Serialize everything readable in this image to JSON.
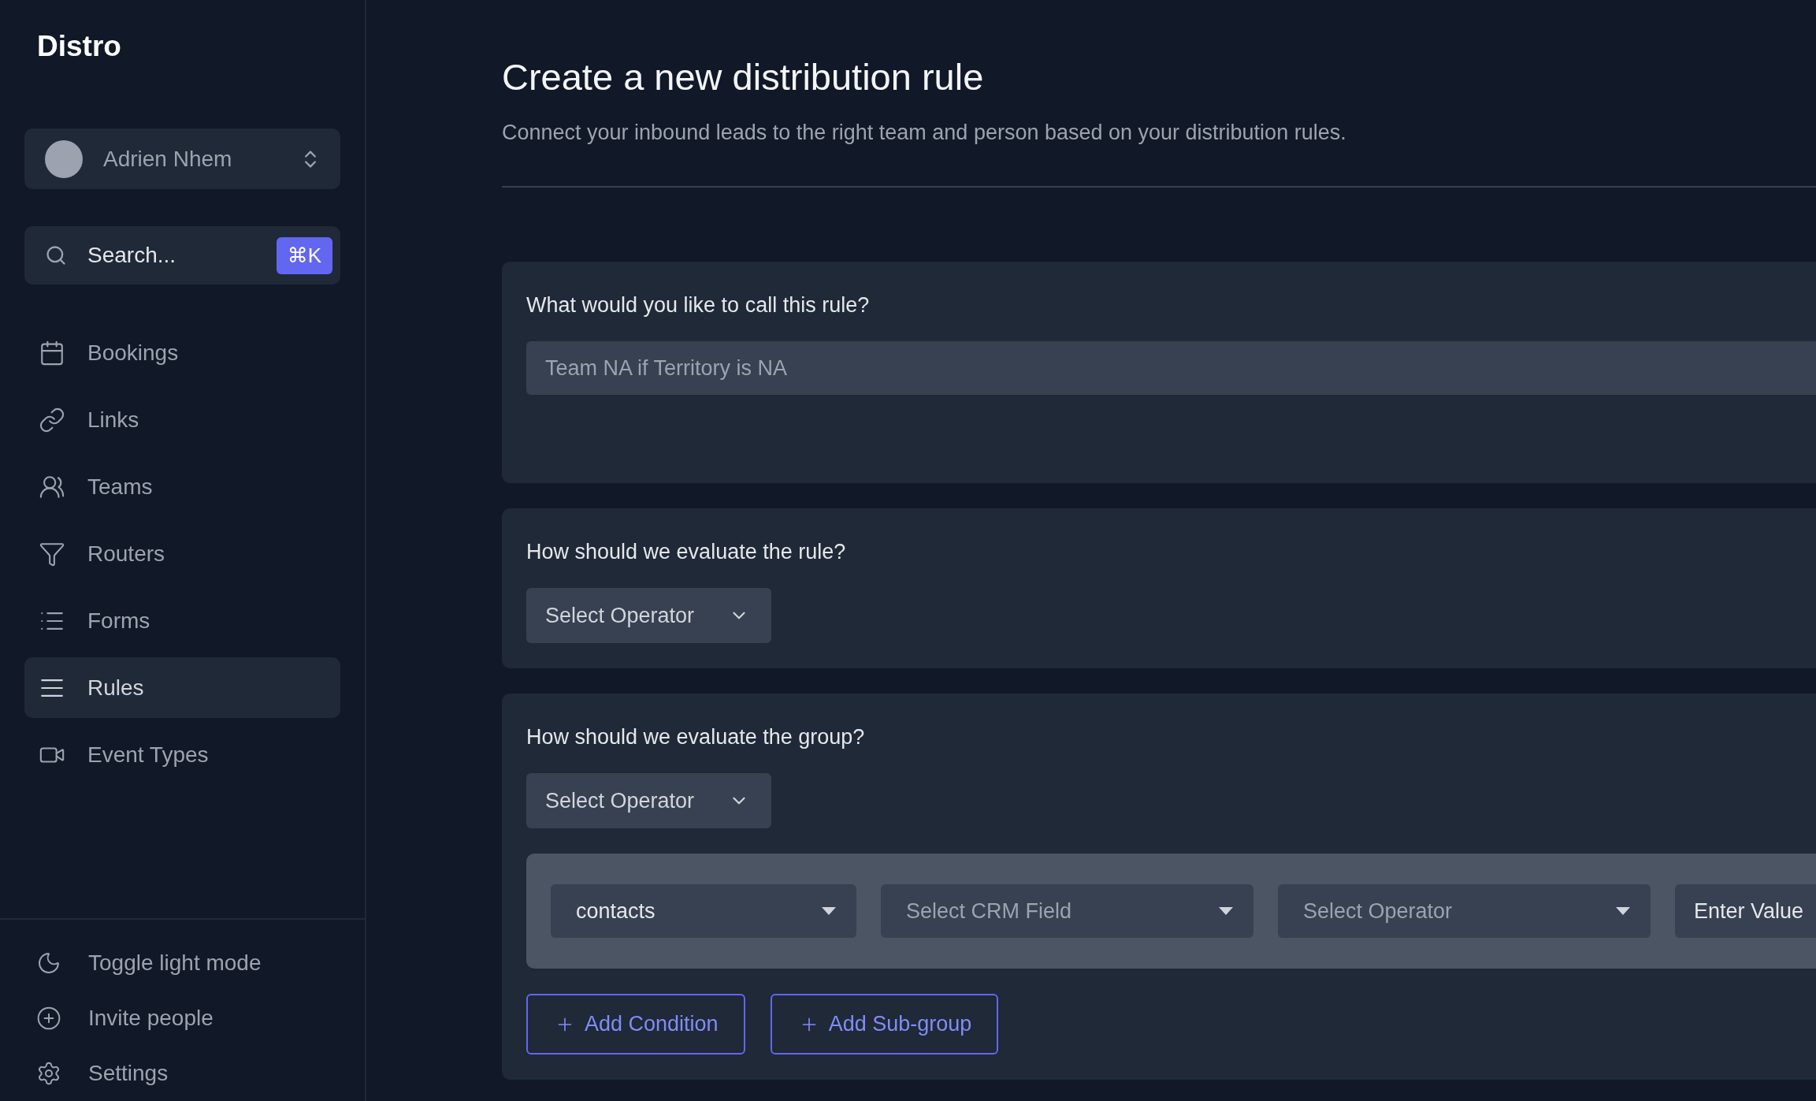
{
  "sidebar": {
    "logo": "Distro",
    "user": {
      "name": "Adrien Nhem"
    },
    "search": {
      "placeholder": "Search...",
      "shortcut": "⌘K"
    },
    "nav": [
      {
        "label": "Bookings",
        "selected": false
      },
      {
        "label": "Links",
        "selected": false
      },
      {
        "label": "Teams",
        "selected": false
      },
      {
        "label": "Routers",
        "selected": false
      },
      {
        "label": "Forms",
        "selected": false
      },
      {
        "label": "Rules",
        "selected": true
      },
      {
        "label": "Event Types",
        "selected": false
      }
    ],
    "footer": [
      {
        "label": "Toggle light mode"
      },
      {
        "label": "Invite people"
      },
      {
        "label": "Settings"
      }
    ]
  },
  "main": {
    "title": "Create a new distribution rule",
    "subtitle": "Connect your inbound leads to the right team and person based on your distribution rules.",
    "sections": [
      {
        "kind": "text",
        "question": "What would you like to call this rule?",
        "placeholder": "Team NA if Territory is NA"
      },
      {
        "kind": "operator",
        "question": "How should we evaluate the rule?",
        "select": "Select Operator"
      },
      {
        "kind": "group",
        "question": "How should we evaluate the group?",
        "select": "Select Operator",
        "condition": [
          {
            "kind": "select",
            "value": "contacts"
          },
          {
            "kind": "select",
            "placeholder": "Select CRM Field"
          },
          {
            "kind": "select",
            "placeholder": "Select Operator"
          },
          {
            "kind": "input",
            "placeholder": "Enter Value"
          }
        ],
        "buttons": [
          "Add Condition",
          "Add Sub-group"
        ]
      }
    ]
  }
}
